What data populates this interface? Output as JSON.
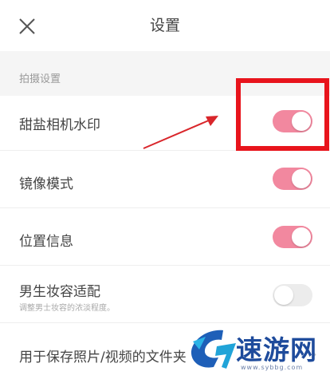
{
  "header": {
    "title": "设置",
    "close_icon": "close-icon"
  },
  "section": {
    "label": "拍摄设置"
  },
  "settings": [
    {
      "label": "甜盐相机水印",
      "state": "on"
    },
    {
      "label": "镜像模式",
      "state": "on"
    },
    {
      "label": "位置信息",
      "state": "on"
    },
    {
      "label": "男生妆容适配",
      "sublabel": "调整男士妆容的浓淡程度。",
      "state": "off"
    },
    {
      "label": "用于保存照片/视频的文件夹"
    }
  ],
  "colors": {
    "toggle_on": "#f2889f",
    "toggle_off": "#ececec",
    "highlight": "#e8141c",
    "watermark": "#1e4b9c"
  },
  "watermark": {
    "brand": "速游网",
    "url": "www.sybbg.com"
  }
}
